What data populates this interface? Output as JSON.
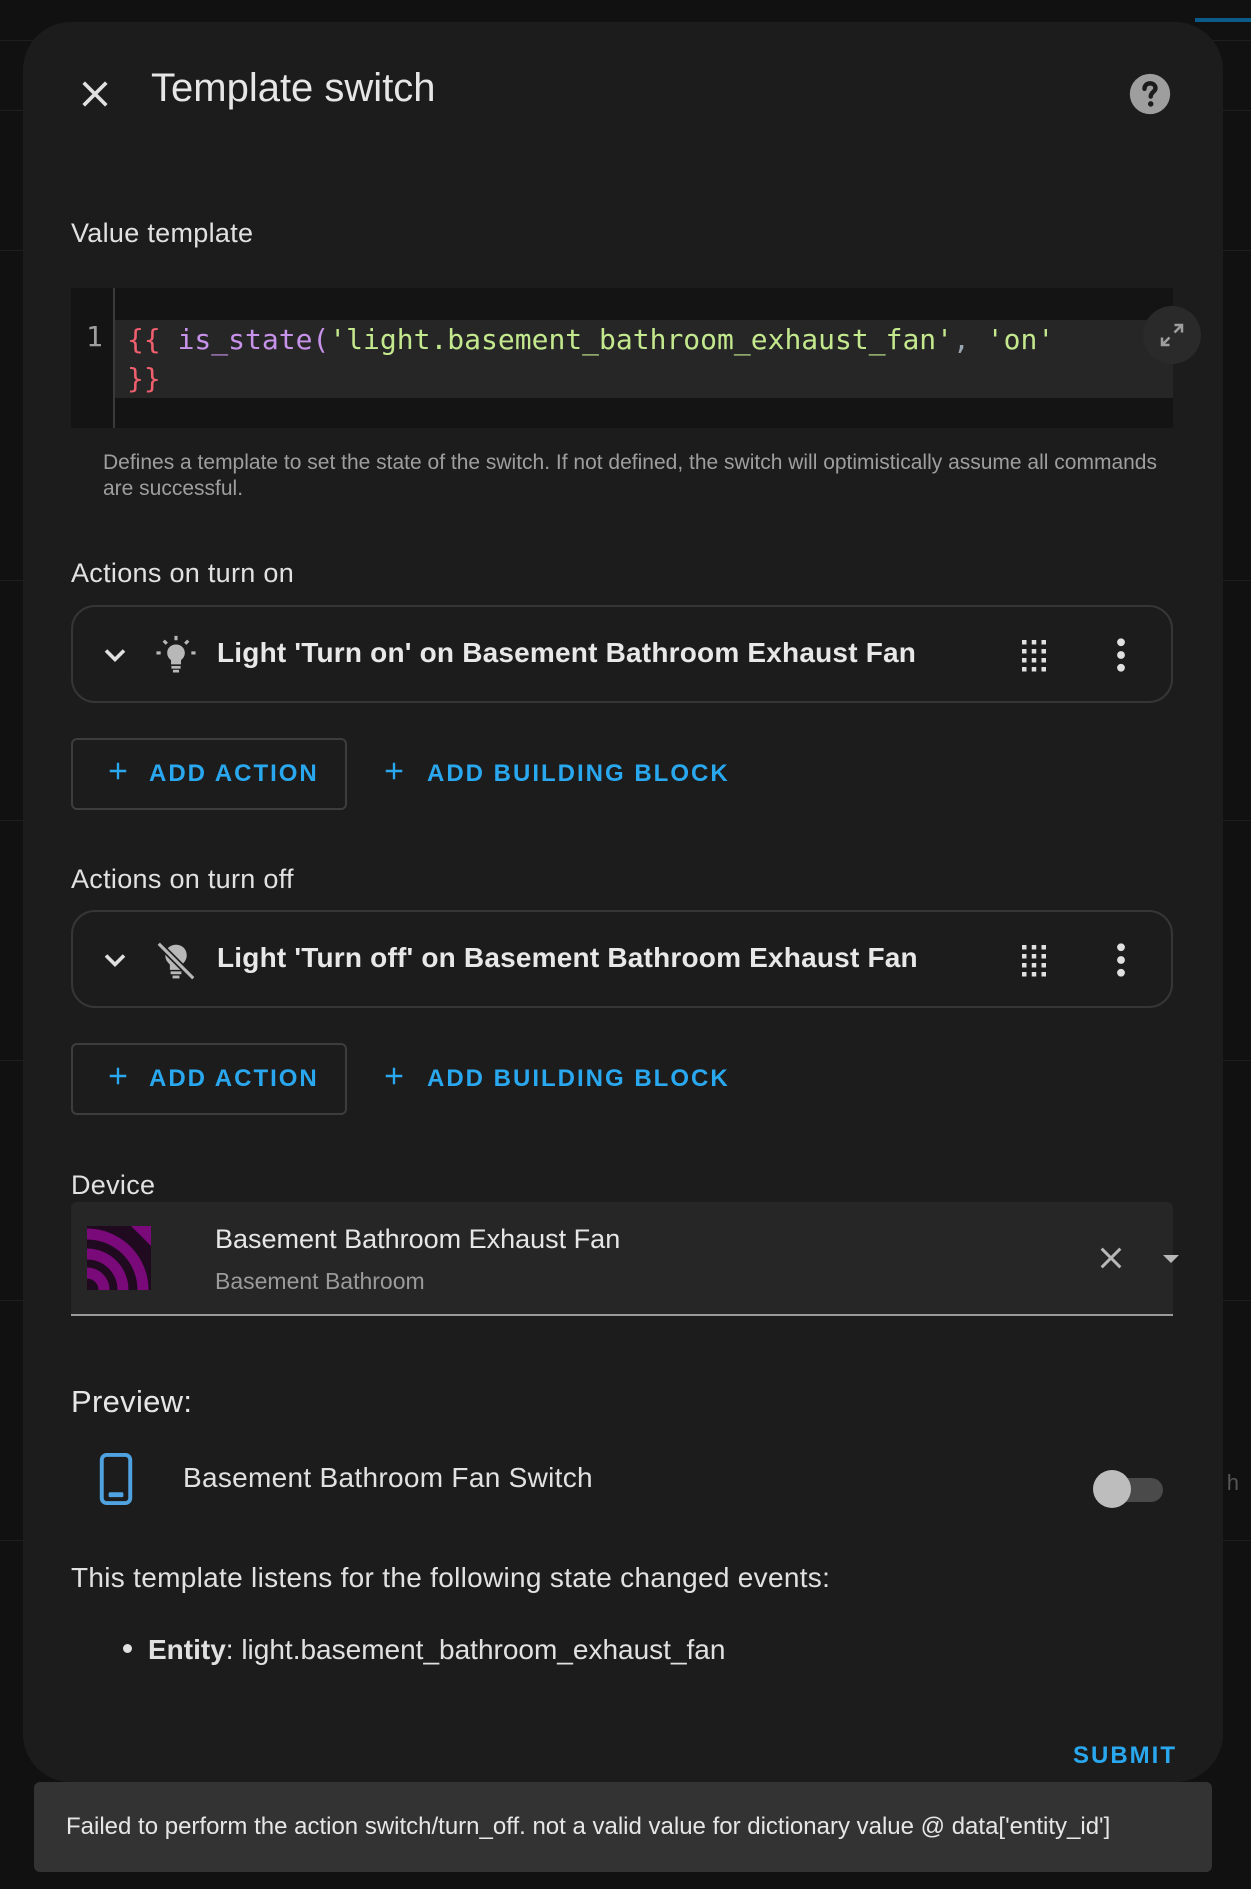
{
  "dialog": {
    "title": "Template switch"
  },
  "value_template": {
    "label": "Value template",
    "line_number": "1",
    "code_line1": {
      "brace_open": "{{",
      "func": " is_state(",
      "arg1": "'light.basement_bathroom_exhaust_fan'",
      "comma": ", ",
      "arg2": "'on'"
    },
    "code_line2": "}}",
    "helper": "Defines a template to set the state of the switch. If not defined, the switch will optimistically assume all commands are successful."
  },
  "turn_on": {
    "label": "Actions on turn on",
    "action_label": "Light 'Turn on' on Basement Bathroom Exhaust Fan",
    "add_action": "ADD ACTION",
    "add_block": "ADD BUILDING BLOCK"
  },
  "turn_off": {
    "label": "Actions on turn off",
    "action_label": "Light 'Turn off' on Basement Bathroom Exhaust Fan",
    "add_action": "ADD ACTION",
    "add_block": "ADD BUILDING BLOCK"
  },
  "device": {
    "label": "Device",
    "name": "Basement Bathroom Exhaust Fan",
    "area": "Basement Bathroom"
  },
  "preview": {
    "label": "Preview:",
    "entity_name": "Basement Bathroom Fan Switch",
    "toggle_on": false,
    "listens_text": "This template listens for the following state changed events:",
    "entity_key": "Entity",
    "entity_value": ": light.basement_bathroom_exhaust_fan"
  },
  "submit_label": "SUBMIT",
  "toast": "Failed to perform the action switch/turn_off. not a valid value for dictionary value @ data['entity_id']",
  "background_fragment": "h",
  "colors": {
    "accent": "#2aa8ef",
    "dialog_bg": "#1c1c1c",
    "device_logo": "#7a0a7a",
    "phone_icon": "#4fa3e0"
  }
}
